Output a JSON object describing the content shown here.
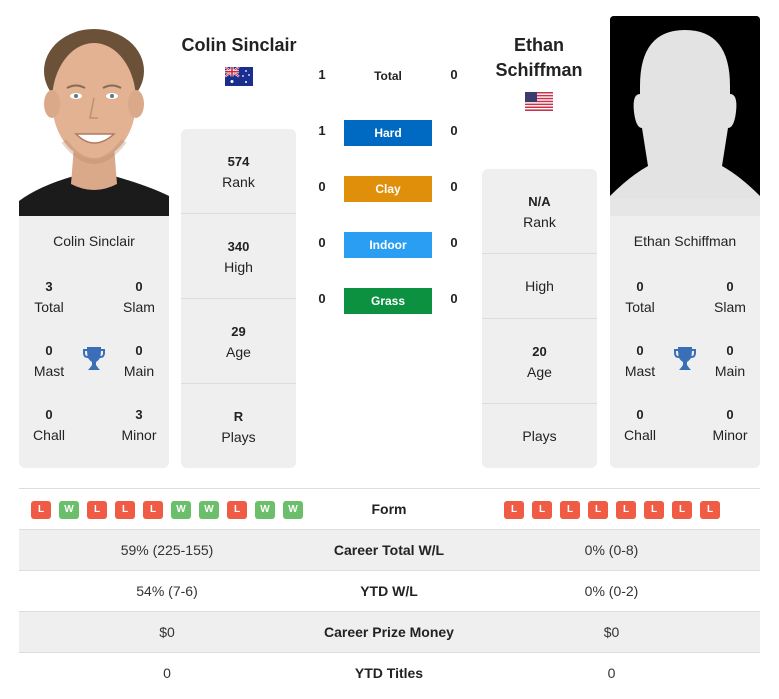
{
  "colors": {
    "hard": "#0069c1",
    "clay": "#e08f0b",
    "indoor": "#2a9ef2",
    "grass": "#0b913f",
    "loss": "#ef5b44",
    "win": "#6bbf6b",
    "trophy": "#3a6fb8"
  },
  "player_left": {
    "name": "Colin Sinclair",
    "flag": "australia-flag",
    "stats": [
      {
        "value": "574",
        "label": "Rank"
      },
      {
        "value": "340",
        "label": "High"
      },
      {
        "value": "29",
        "label": "Age"
      },
      {
        "value": "R",
        "label": "Plays"
      }
    ],
    "titles": {
      "total": {
        "value": "3",
        "label": "Total"
      },
      "slam": {
        "value": "0",
        "label": "Slam"
      },
      "mast": {
        "value": "0",
        "label": "Mast"
      },
      "main": {
        "value": "0",
        "label": "Main"
      },
      "chall": {
        "value": "0",
        "label": "Chall"
      },
      "minor": {
        "value": "3",
        "label": "Minor"
      }
    },
    "form": [
      "L",
      "W",
      "L",
      "L",
      "L",
      "W",
      "W",
      "L",
      "W",
      "W"
    ]
  },
  "player_right": {
    "name_line1": "Ethan",
    "name_line2": "Schiffman",
    "name": "Ethan Schiffman",
    "flag": "usa-flag",
    "stats": [
      {
        "value": "N/A",
        "label": "Rank"
      },
      {
        "value": "",
        "label": "High"
      },
      {
        "value": "20",
        "label": "Age"
      },
      {
        "value": "",
        "label": "Plays"
      }
    ],
    "titles": {
      "total": {
        "value": "0",
        "label": "Total"
      },
      "slam": {
        "value": "0",
        "label": "Slam"
      },
      "mast": {
        "value": "0",
        "label": "Mast"
      },
      "main": {
        "value": "0",
        "label": "Main"
      },
      "chall": {
        "value": "0",
        "label": "Chall"
      },
      "minor": {
        "value": "0",
        "label": "Minor"
      }
    },
    "form": [
      "L",
      "L",
      "L",
      "L",
      "L",
      "L",
      "L",
      "L"
    ]
  },
  "h2h": [
    {
      "label": "Total",
      "left": "1",
      "right": "0"
    },
    {
      "label": "Hard",
      "left": "1",
      "right": "0"
    },
    {
      "label": "Clay",
      "left": "0",
      "right": "0"
    },
    {
      "label": "Indoor",
      "left": "0",
      "right": "0"
    },
    {
      "label": "Grass",
      "left": "0",
      "right": "0"
    }
  ],
  "comparison": [
    {
      "label": "Form"
    },
    {
      "label": "Career Total W/L",
      "left": "59% (225-155)",
      "right": "0% (0-8)"
    },
    {
      "label": "YTD W/L",
      "left": "54% (7-6)",
      "right": "0% (0-2)"
    },
    {
      "label": "Career Prize Money",
      "left": "$0",
      "right": "$0"
    },
    {
      "label": "YTD Titles",
      "left": "0",
      "right": "0"
    }
  ]
}
